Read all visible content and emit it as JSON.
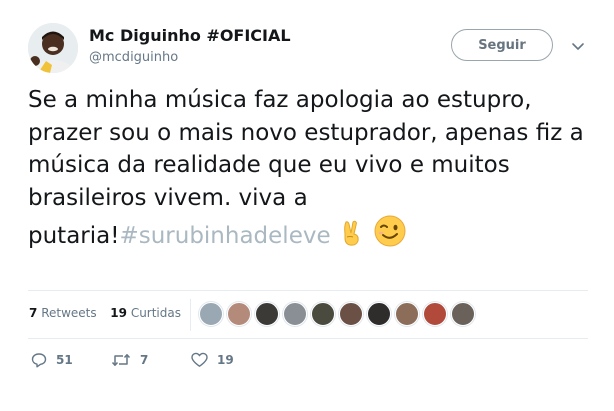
{
  "author": {
    "name": "Mc Diguinho #OFICIAL",
    "handle": "@mcdiguinho"
  },
  "follow_button": "Seguir",
  "tweet": {
    "text": "Se a minha música faz apologia ao estupro, prazer sou o mais novo estuprador, apenas fiz a música da realidade que eu vivo e muitos brasileiros vivem. viva a putaria!",
    "hashtag": "#surubinhadeleve",
    "emojis": [
      "victory-hand",
      "winking-face"
    ]
  },
  "stats": {
    "retweets_count": "7",
    "retweets_label": "Retweets",
    "likes_count": "19",
    "likes_label": "Curtidas"
  },
  "liker_avatars": [
    "#9aa8b3",
    "#b48a7a",
    "#3b3a36",
    "#8a8f95",
    "#4a4a3e",
    "#6b5046",
    "#2e2d2b",
    "#8b6d5a",
    "#b24a3c",
    "#6a625a"
  ],
  "actions": {
    "replies": "51",
    "retweets": "7",
    "likes": "19"
  },
  "colors": {
    "hashtag": "#aab8c2",
    "secondary_text": "#657786",
    "divider": "#e6ecf0"
  }
}
